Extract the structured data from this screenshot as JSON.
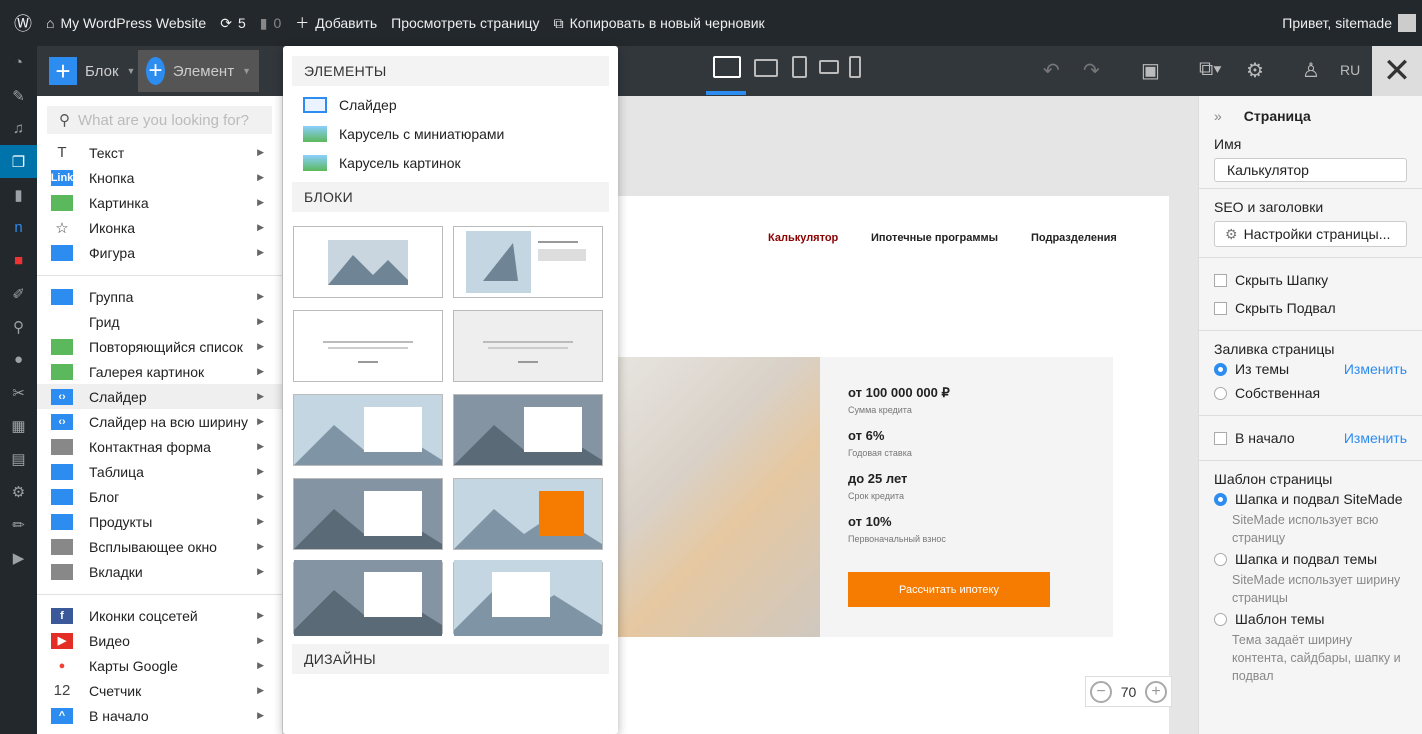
{
  "adminbar": {
    "site": "My WordPress Website",
    "updates": "5",
    "comments": "0",
    "add": "Добавить",
    "view": "Просмотреть страницу",
    "copy": "Копировать в новый черновик",
    "greeting": "Привет, sitemade"
  },
  "toolbar": {
    "block": "Блок",
    "element": "Элемент",
    "lang": "RU"
  },
  "search": {
    "placeholder": "What are you looking for?"
  },
  "menu": [
    [
      {
        "label": "Текст",
        "icon": "text-icon",
        "c": "#fff",
        "g": "T"
      },
      {
        "label": "Кнопка",
        "icon": "link-button-icon",
        "c": "#2d8cf0",
        "g": "Link"
      },
      {
        "label": "Картинка",
        "icon": "image-icon",
        "c": "#5cb85c",
        "g": ""
      },
      {
        "label": "Иконка",
        "icon": "star-icon",
        "c": "#fff",
        "g": "☆"
      },
      {
        "label": "Фигура",
        "icon": "shape-icon",
        "c": "#2d8cf0",
        "g": ""
      }
    ],
    [
      {
        "label": "Группа",
        "icon": "group-icon",
        "c": "#2d8cf0",
        "g": ""
      },
      {
        "label": "Грид",
        "icon": "grid-icon",
        "c": "#fff",
        "g": ""
      },
      {
        "label": "Повторяющийся список",
        "icon": "repeater-icon",
        "c": "#5cb85c",
        "g": ""
      },
      {
        "label": "Галерея картинок",
        "icon": "gallery-icon",
        "c": "#5cb85c",
        "g": ""
      },
      {
        "label": "Слайдер",
        "icon": "slider-icon",
        "c": "#2d8cf0",
        "g": "‹›",
        "sel": true
      },
      {
        "label": "Слайдер на всю ширину",
        "icon": "fullwidth-slider-icon",
        "c": "#2d8cf0",
        "g": "‹›"
      },
      {
        "label": "Контактная форма",
        "icon": "form-icon",
        "c": "#888",
        "g": ""
      },
      {
        "label": "Таблица",
        "icon": "table-icon",
        "c": "#2d8cf0",
        "g": ""
      },
      {
        "label": "Блог",
        "icon": "blog-icon",
        "c": "#2d8cf0",
        "g": ""
      },
      {
        "label": "Продукты",
        "icon": "products-icon",
        "c": "#2d8cf0",
        "g": ""
      },
      {
        "label": "Всплывающее окно",
        "icon": "popup-icon",
        "c": "#888",
        "g": ""
      },
      {
        "label": "Вкладки",
        "icon": "tabs-icon",
        "c": "#888",
        "g": ""
      }
    ],
    [
      {
        "label": "Иконки соцсетей",
        "icon": "social-icon",
        "c": "#3b5998",
        "g": "f"
      },
      {
        "label": "Видео",
        "icon": "youtube-icon",
        "c": "#e52d27",
        "g": "▶"
      },
      {
        "label": "Карты Google",
        "icon": "map-pin-icon",
        "c": "#ea4335",
        "g": "●"
      },
      {
        "label": "Счетчик",
        "icon": "counter-icon",
        "c": "#fff",
        "g": "12"
      },
      {
        "label": "В начало",
        "icon": "scroll-top-icon",
        "c": "#2d8cf0",
        "g": "^"
      }
    ]
  ],
  "dropdown": {
    "elements_header": "ЭЛЕМЕНТЫ",
    "elements": [
      "Слайдер",
      "Карусель с миниатюрами",
      "Карусель картинок"
    ],
    "blocks_header": "БЛОКИ",
    "designs_header": "ДИЗАЙНЫ",
    "block_count": 10
  },
  "canvas": {
    "nav": [
      "Калькулятор",
      "Ипотечные программы",
      "Подразделения"
    ],
    "nav_active_color": "#8b0000",
    "stats": [
      {
        "value": "от 100 000 000 ₽",
        "label": "Сумма кредита"
      },
      {
        "value": "от 6%",
        "label": "Годовая ставка"
      },
      {
        "value": "до 25 лет",
        "label": "Срок кредита"
      },
      {
        "value": "от 10%",
        "label": "Первоначальный взнос"
      }
    ],
    "cta": "Рассчитать ипотеку",
    "zoom": "70"
  },
  "panel": {
    "title": "Страница",
    "name_label": "Имя",
    "name_value": "Калькулятор",
    "seo_label": "SEO и заголовки",
    "settings_btn": "Настройки страницы...",
    "hide_header": "Скрыть Шапку",
    "hide_footer": "Скрыть Подвал",
    "fill_label": "Заливка страницы",
    "fill_theme": "Из темы",
    "fill_own": "Собственная",
    "change": "Изменить",
    "to_top": "В начало",
    "template_label": "Шаблон страницы",
    "templates": [
      {
        "label": "Шапка и подвал SiteMade",
        "desc": "SiteMade использует всю страницу",
        "on": true
      },
      {
        "label": "Шапка и подвал темы",
        "desc": "SiteMade использует ширину страницы",
        "on": false
      },
      {
        "label": "Шаблон темы",
        "desc": "Тема задаёт ширину контента, сайдбары, шапку и подвал",
        "on": false
      }
    ]
  },
  "colors": {
    "accent": "#2d8cf0",
    "cta": "#f57c00"
  }
}
